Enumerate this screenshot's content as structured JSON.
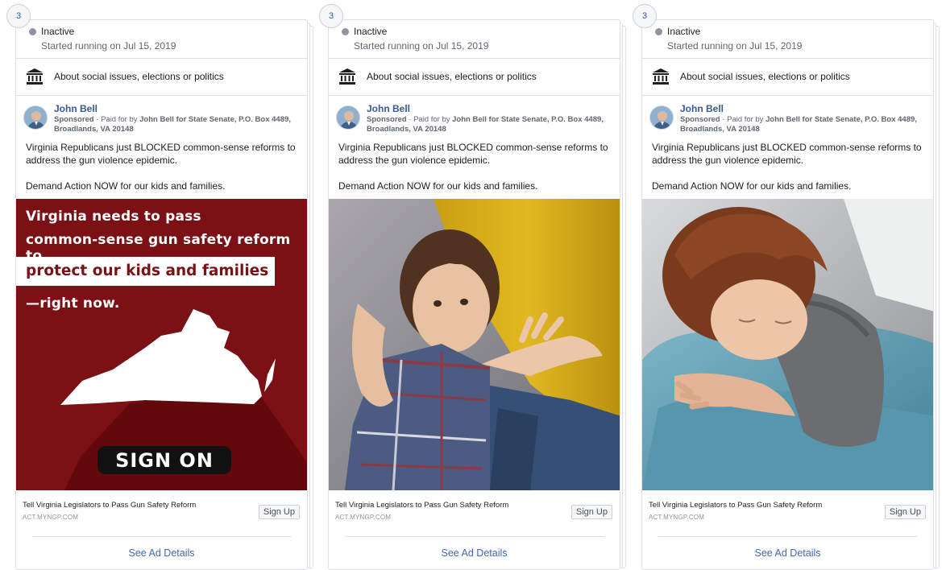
{
  "ads": [
    {
      "count_badge": "3",
      "status": "Inactive",
      "started": "Started running on Jul 15, 2019",
      "category": "About social issues, elections or politics",
      "advertiser": "John Bell",
      "sponsored_label": "Sponsored",
      "paid_for_prefix": "Paid for by",
      "paid_for_entity": "John Bell for State Senate, P.O. Box 4489, Broadlands, VA 20148",
      "body_line1": "Virginia Republicans just BLOCKED common-sense reforms to address the gun violence epidemic.",
      "body_line2": "Demand Action NOW for our kids and families.",
      "media_type": "poster",
      "poster": {
        "line1": "Virginia needs to pass",
        "line2": "common-sense gun safety reform to",
        "highlight": "protect our kids and families",
        "line3": "—right now.",
        "cta": "SIGN ON",
        "background_color": "#7b1015"
      },
      "link_title": "Tell Virginia Legislators to Pass Gun Safety Reform",
      "link_domain": "ACT.MYNGP.COM",
      "cta_button": "Sign Up",
      "details_link": "See Ad Details"
    },
    {
      "count_badge": "3",
      "status": "Inactive",
      "started": "Started running on Jul 15, 2019",
      "category": "About social issues, elections or politics",
      "advertiser": "John Bell",
      "sponsored_label": "Sponsored",
      "paid_for_prefix": "Paid for by",
      "paid_for_entity": "John Bell for State Senate, P.O. Box 4489, Broadlands, VA 20148",
      "body_line1": "Virginia Republicans just BLOCKED common-sense reforms to address the gun violence epidemic.",
      "body_line2": "Demand Action NOW for our kids and families.",
      "media_type": "photo-child-hugging-adult-yellow-sweater",
      "link_title": "Tell Virginia Legislators to Pass Gun Safety Reform",
      "link_domain": "ACT.MYNGP.COM",
      "cta_button": "Sign Up",
      "details_link": "See Ad Details"
    },
    {
      "count_badge": "3",
      "status": "Inactive",
      "started": "Started running on Jul 15, 2019",
      "category": "About social issues, elections or politics",
      "advertiser": "John Bell",
      "sponsored_label": "Sponsored",
      "paid_for_prefix": "Paid for by",
      "paid_for_entity": "John Bell for State Senate, P.O. Box 4489, Broadlands, VA 20148",
      "body_line1": "Virginia Republicans just BLOCKED common-sense reforms to address the gun violence epidemic.",
      "body_line2": "Demand Action NOW for our kids and families.",
      "media_type": "photo-child-hugging-adult-blue-shirt",
      "link_title": "Tell Virginia Legislators to Pass Gun Safety Reform",
      "link_domain": "ACT.MYNGP.COM",
      "cta_button": "Sign Up",
      "details_link": "See Ad Details"
    }
  ],
  "icons": {
    "status": "status-dot-icon",
    "category": "government-building-icon",
    "avatar": "advertiser-avatar"
  },
  "colors": {
    "link_blue": "#385898",
    "details_blue": "#4267b2",
    "inactive_gray": "#90949c",
    "poster_red": "#7b1015"
  }
}
